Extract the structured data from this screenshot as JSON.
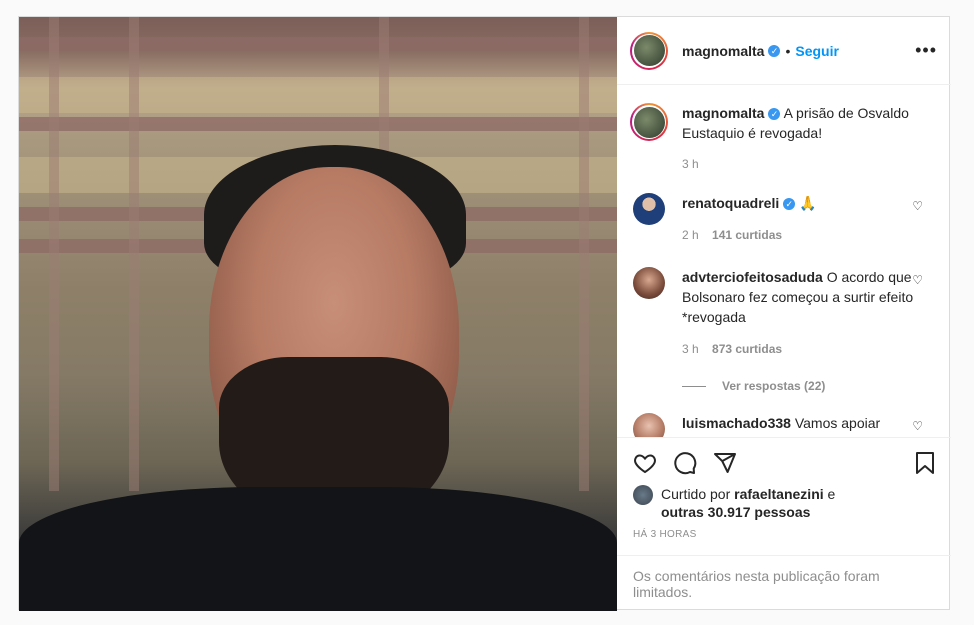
{
  "post": {
    "username": "magnomalta",
    "follow_label": "Seguir",
    "dot": "•",
    "more_label": "•••",
    "caption": "A prisão de Osvaldo Eustaquio é revogada!",
    "caption_time": "3 h"
  },
  "comments": [
    {
      "username": "renatoquadreli",
      "text": "🙏",
      "time": "2 h",
      "likes": "141 curtidas"
    },
    {
      "username": "advterciofeitosaduda",
      "text": "O acordo que Bolsonaro fez começou a surtir efeito *revogada",
      "time": "3 h",
      "likes": "873 curtidas",
      "replies": "Ver respostas (22)"
    },
    {
      "username": "luismachado338",
      "text": "Vamos apoiar nosso Presidente"
    }
  ],
  "likes": {
    "prefix": "Curtido por",
    "user": "rafaeltanezini",
    "connector": "e",
    "others": "outras 30.917 pessoas"
  },
  "time_ago": "HÁ 3 HORAS",
  "limited_notice": "Os comentários nesta publicação foram limitados.",
  "colors": {
    "link": "#0095f6",
    "verified": "#3897f0",
    "muted": "#8e8e8e"
  },
  "icons": [
    "heart-icon",
    "comment-icon",
    "share-icon",
    "bookmark-icon",
    "verified-icon",
    "more-icon"
  ]
}
